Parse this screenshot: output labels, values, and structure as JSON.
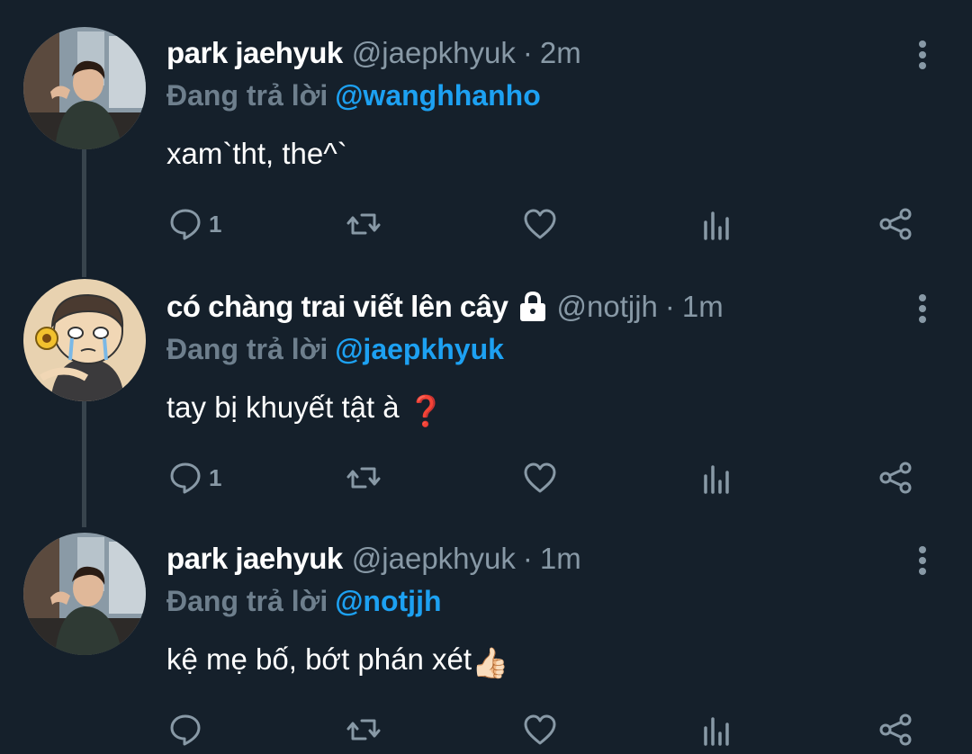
{
  "colors": {
    "background": "#15202b",
    "accent": "#1da1f2",
    "muted": "#8899a6",
    "thread_line": "#38444d"
  },
  "tweets": [
    {
      "name": "park jaehyuk",
      "handle": "@jaepkhyuk",
      "dot": "·",
      "time": "2m",
      "reply_label": "Đang trả lời",
      "reply_to": "@wanghhanho",
      "text": "xam`tht, the^`",
      "reply_count": "1",
      "protected": false,
      "avatar": "photo-person"
    },
    {
      "name": "có chàng trai viết lên cây",
      "handle": "@notjjh",
      "dot": "·",
      "time": "1m",
      "reply_label": "Đang trả lời",
      "reply_to": "@jaepkhyuk",
      "text": "tay bị khuyết tật à",
      "text_emoji": "❓",
      "reply_count": "1",
      "protected": true,
      "avatar": "cartoon-crying-boy"
    },
    {
      "name": "park jaehyuk",
      "handle": "@jaepkhyuk",
      "dot": "·",
      "time": "1m",
      "reply_label": "Đang trả lời",
      "reply_to": "@notjjh",
      "text": "kệ mẹ bố, bớt phán xét",
      "text_emoji": "👍🏻",
      "reply_count": "",
      "protected": false,
      "avatar": "photo-person"
    }
  ],
  "icons": {
    "reply": "reply-icon",
    "retweet": "retweet-icon",
    "like": "like-icon",
    "analytics": "analytics-icon",
    "share": "share-icon",
    "more": "more-icon",
    "lock": "lock-icon"
  }
}
